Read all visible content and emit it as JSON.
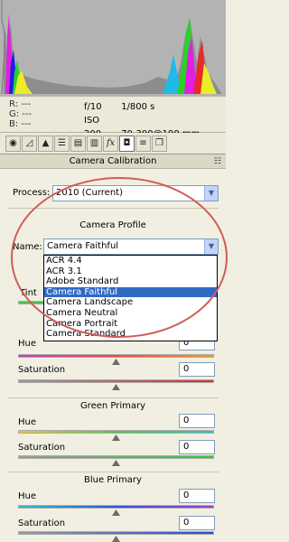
{
  "readout": {
    "r": "R:  ---",
    "g": "G:  ---",
    "b": "B:  ---",
    "aperture": "f/10",
    "shutter": "1/800 s",
    "iso": "ISO 200",
    "lens": "70-300@190 mm"
  },
  "tabs": [
    {
      "icon": "aperture-icon"
    },
    {
      "icon": "tone-curve-icon"
    },
    {
      "icon": "detail-icon"
    },
    {
      "icon": "hsl-icon"
    },
    {
      "icon": "split-toning-icon"
    },
    {
      "icon": "lens-corrections-icon"
    },
    {
      "icon": "fx-icon",
      "glyph": "fx"
    },
    {
      "icon": "camera-calibration-icon"
    },
    {
      "icon": "presets-icon"
    },
    {
      "icon": "snapshots-icon"
    }
  ],
  "panel": {
    "title": "Camera Calibration",
    "process_label": "Process:",
    "process_value": "2010 (Current)",
    "camera_profile_title": "Camera Profile",
    "name_label": "Name:",
    "name_value": "Camera Faithful",
    "profile_options": [
      "ACR 4.4",
      "ACR 3.1",
      "Adobe Standard",
      "Camera Faithful",
      "Camera Landscape",
      "Camera Neutral",
      "Camera Portrait",
      "Camera Standard"
    ],
    "selected_option": "Camera Faithful",
    "tint_label": "Tint",
    "red_hue_label": "Hue",
    "red_hue_value": "0",
    "red_saturation_label": "Saturation",
    "red_saturation_value": "0",
    "green_title": "Green Primary",
    "green_hue_label": "Hue",
    "green_hue_value": "0",
    "green_saturation_label": "Saturation",
    "green_saturation_value": "0",
    "blue_title": "Blue Primary",
    "blue_hue_label": "Hue",
    "blue_hue_value": "0",
    "blue_saturation_label": "Saturation",
    "blue_saturation_value": "0"
  },
  "colors": {
    "annotation_oval": "#cf5d55",
    "selection": "#316ac5",
    "histogram_bg": "#b3b3b3"
  }
}
